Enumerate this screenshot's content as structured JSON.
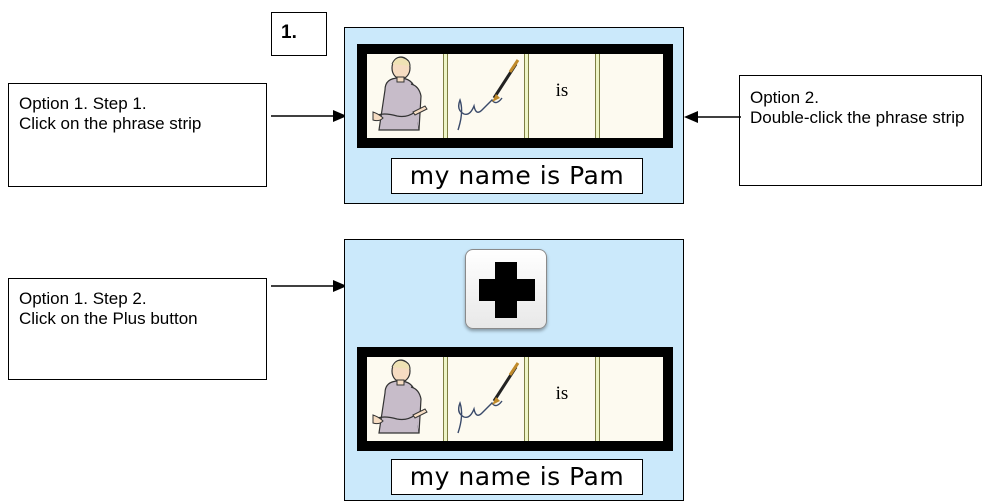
{
  "step_number": "1.",
  "callouts": {
    "option1_step1": {
      "title": "Option 1. Step 1.",
      "body": "Click on the phrase strip"
    },
    "option2": {
      "title": "Option 2.",
      "body": "Double-click the phrase strip"
    },
    "option1_step2": {
      "title": "Option 1. Step 2.",
      "body": "Click on the Plus button"
    }
  },
  "panel_top": {
    "cells": {
      "word": "is"
    },
    "phrase_text": "my name is Pam"
  },
  "panel_bottom": {
    "plus_button": {
      "icon": "plus-icon"
    },
    "cells": {
      "word": "is"
    },
    "phrase_text": "my name is Pam"
  },
  "colors": {
    "panel_background": "#cbe9fb",
    "strip_border": "#000000",
    "separator": "#eef5c7"
  }
}
